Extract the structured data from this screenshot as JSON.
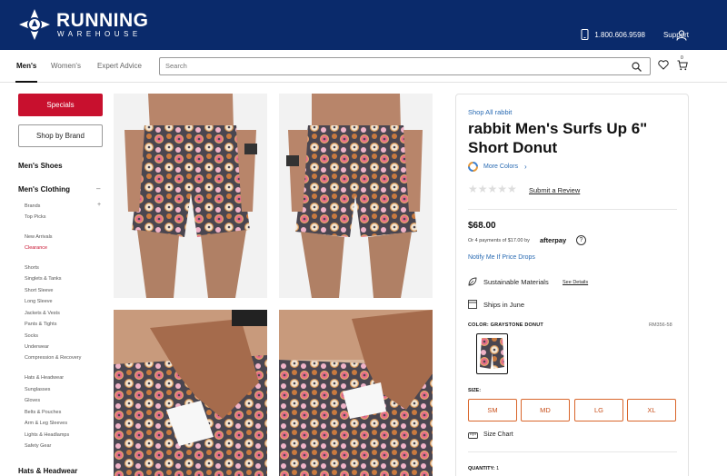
{
  "header": {
    "logo_main": "RUNNING",
    "logo_sub": "WAREHOUSE",
    "phone": "1.800.606.9598",
    "support": "Support"
  },
  "nav": {
    "tabs": [
      {
        "label": "Men's",
        "active": true
      },
      {
        "label": "Women's",
        "active": false
      },
      {
        "label": "Expert Advice",
        "active": false
      }
    ],
    "search_placeholder": "Search",
    "cart_count": "0"
  },
  "sidebar": {
    "specials": "Specials",
    "shop_by_brand": "Shop by Brand",
    "mens_shoes": "Men's Shoes",
    "mens_clothing": "Men's Clothing",
    "clothing_toggle": "–",
    "brands_toggle": "+",
    "items": [
      "Brands",
      "Top Picks",
      "New Arrivals",
      "Clearance",
      "Shorts",
      "Singlets & Tanks",
      "Short Sleeve",
      "Long Sleeve",
      "Jackets & Vests",
      "Pants & Tights",
      "Socks",
      "Underwear",
      "Compression & Recovery",
      "Hats & Headwear",
      "Sunglasses",
      "Gloves",
      "Belts & Pouches",
      "Arm & Leg Sleeves",
      "Lights & Headlamps",
      "Safety Gear"
    ],
    "hats_headwear": "Hats & Headwear"
  },
  "product": {
    "brand_link": "Shop All rabbit",
    "title": "rabbit Men's Surfs Up 6\" Short Donut",
    "more_colors": "More Colors",
    "more_colors_chevron": "›",
    "stars": "★★★★★",
    "rating": 0,
    "submit_review": "Submit a Review",
    "price": "$68.00",
    "afterpay_text": "Or 4 payments of $17.00 by",
    "afterpay_brand": "afterpay",
    "afterpay_info": "?",
    "notify": "Notify Me If Price Drops",
    "sustainable": "Sustainable Materials",
    "see_details": "See Details",
    "ships": "Ships in June",
    "color_label": "COLOR: GRAYSTONE DONUT",
    "sku": "RM356-58",
    "size_label": "SIZE:",
    "sizes": [
      "SM",
      "MD",
      "LG",
      "XL"
    ],
    "size_chart": "Size Chart",
    "quantity_label": "QUANTITY:",
    "quantity": "1"
  },
  "colors": {
    "header_bg": "#0a2a6b",
    "accent_red": "#c8102e",
    "link_blue": "#2a6bb3",
    "size_border": "#d9662b"
  }
}
